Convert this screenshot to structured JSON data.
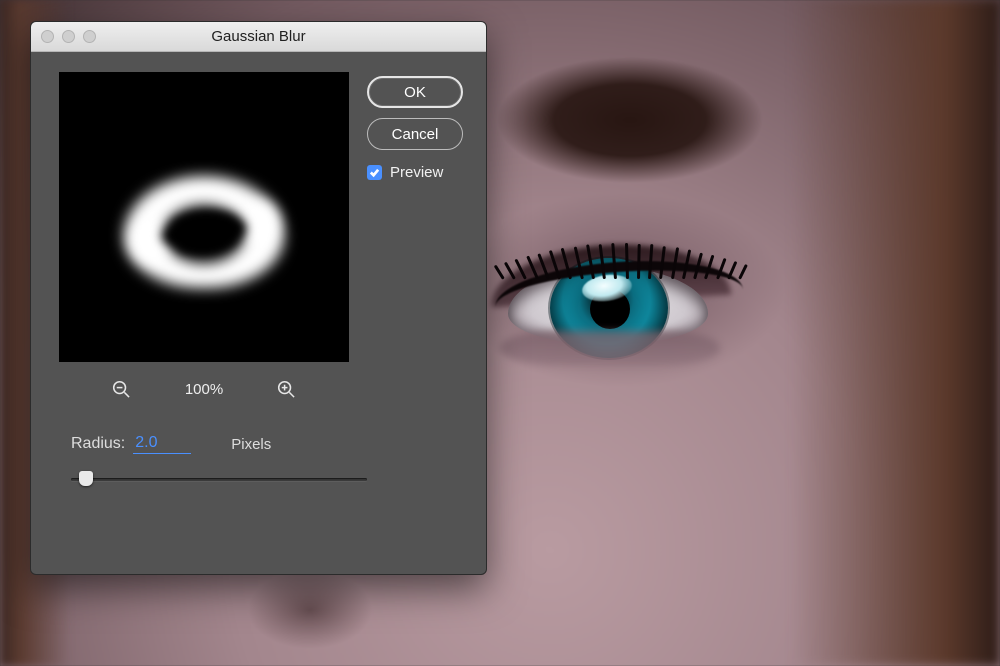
{
  "dialog": {
    "title": "Gaussian Blur",
    "ok_label": "OK",
    "cancel_label": "Cancel",
    "preview_label": "Preview",
    "preview_checked": true,
    "zoom_pct": "100%",
    "radius_label": "Radius:",
    "radius_value": "2.0",
    "radius_unit": "Pixels",
    "slider_pct": 3
  }
}
